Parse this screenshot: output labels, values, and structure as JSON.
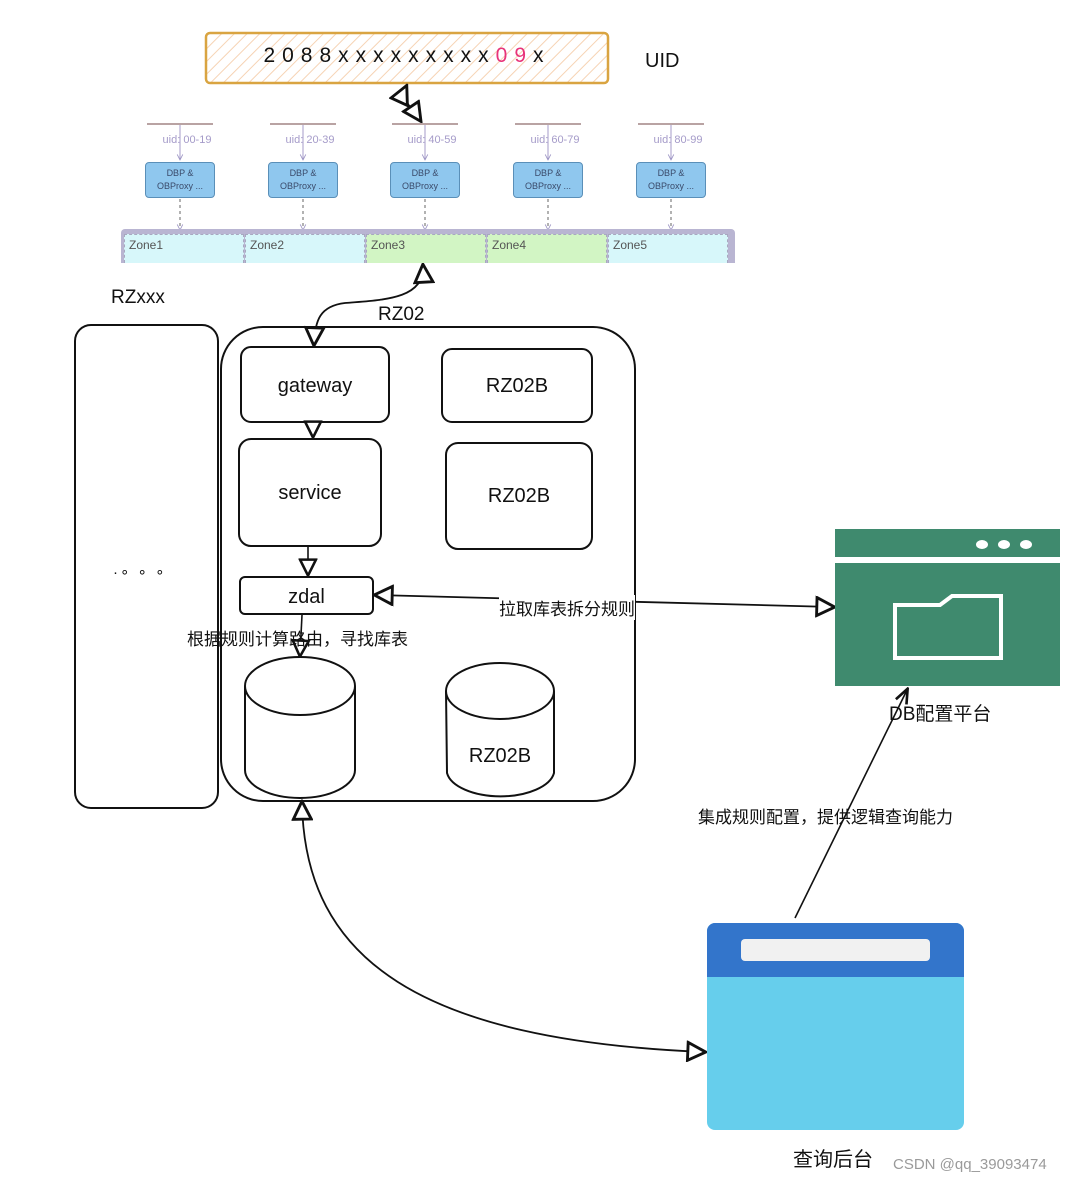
{
  "uid_banner": {
    "prefix": "2088xxxxxxxxx",
    "highlight": "09",
    "suffix": "x",
    "title": "UID",
    "highlight_color": "#e8347a",
    "border_color": "#d9a441"
  },
  "shards": [
    {
      "range": "uid: 00-19",
      "proxy_line1": "DBP &",
      "proxy_line2": "OBProxy ..."
    },
    {
      "range": "uid: 20-39",
      "proxy_line1": "DBP &",
      "proxy_line2": "OBProxy ..."
    },
    {
      "range": "uid: 40-59",
      "proxy_line1": "DBP &",
      "proxy_line2": "OBProxy ..."
    },
    {
      "range": "uid: 60-79",
      "proxy_line1": "DBP &",
      "proxy_line2": "OBProxy ..."
    },
    {
      "range": "uid: 80-99",
      "proxy_line1": "DBP &",
      "proxy_line2": "OBProxy ..."
    }
  ],
  "zones": [
    {
      "label": "Zone1",
      "tone": "cyan"
    },
    {
      "label": "Zone2",
      "tone": "cyan"
    },
    {
      "label": "Zone3",
      "tone": "green"
    },
    {
      "label": "Zone4",
      "tone": "green"
    },
    {
      "label": "Zone5",
      "tone": "cyan"
    }
  ],
  "rzxxx": {
    "title": "RZxxx",
    "ellipsis": "·∘ ∘ ∘"
  },
  "rz02": {
    "title": "RZ02",
    "gateway": "gateway",
    "service": "service",
    "zdal": "zdal",
    "rz02b_1": "RZ02B",
    "rz02b_2": "RZ02B",
    "rz02b_db": "RZ02B"
  },
  "edges": {
    "pull_rules": "拉取库表拆分规则",
    "route_calc": "根据规则计算路由，寻找库表",
    "integrate_rules": "集成规则配置，提供逻辑查询能力"
  },
  "db_config_platform": {
    "label": "DB配置平台",
    "color": "#3f8a6e"
  },
  "query_backend": {
    "label": "查询后台",
    "header_color": "#3375cb",
    "body_color": "#66ceec"
  },
  "watermark": "CSDN @qq_39093474"
}
